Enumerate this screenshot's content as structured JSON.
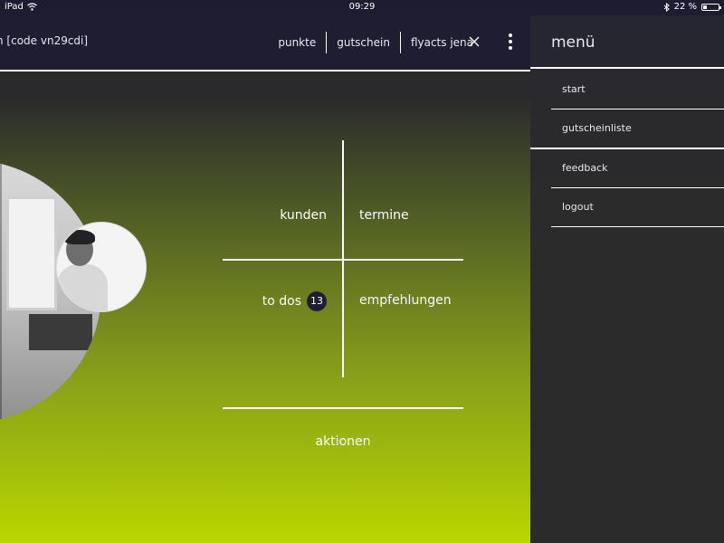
{
  "status_bar": {
    "device": "iPad",
    "time": "09:29",
    "battery_text": "22 %",
    "battery_level": 0.22
  },
  "topbar": {
    "code_label": "n [code vn29cdi]",
    "tabs": [
      "punkte",
      "gutschein",
      "flyacts jena"
    ]
  },
  "dashboard": {
    "kunden": "kunden",
    "termine": "termine",
    "todos": "to dos",
    "todos_count": "13",
    "empfehlungen": "empfehlungen",
    "aktionen": "aktionen"
  },
  "menu": {
    "title": "menü",
    "items": [
      "start",
      "gutscheinliste",
      "feedback",
      "logout"
    ]
  },
  "colors": {
    "navbar": "#1e1d31",
    "gradient_bottom": "#b9d600",
    "menu_bg": "#2b2b2b"
  }
}
